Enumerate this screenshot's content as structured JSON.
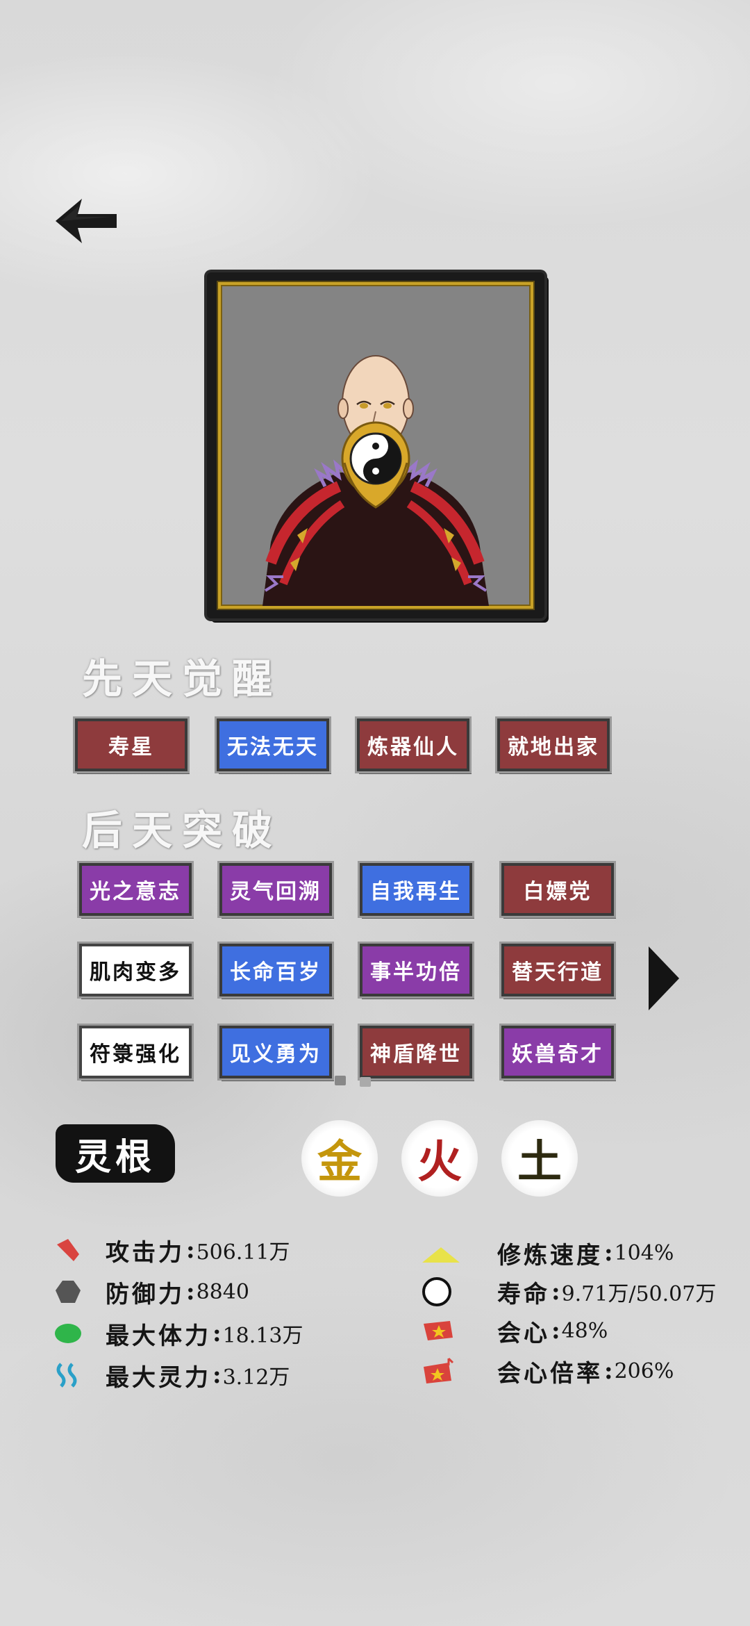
{
  "section_titles": {
    "innate": "先天觉醒",
    "acquired": "后天突破"
  },
  "innate_traits": [
    {
      "label": "寿星",
      "color": "red"
    },
    {
      "label": "无法无天",
      "color": "blue"
    },
    {
      "label": "炼器仙人",
      "color": "red"
    },
    {
      "label": "就地出家",
      "color": "red"
    }
  ],
  "acquired_traits": [
    {
      "label": "光之意志",
      "color": "purple"
    },
    {
      "label": "灵气回溯",
      "color": "purple"
    },
    {
      "label": "自我再生",
      "color": "blue"
    },
    {
      "label": "白嫖党",
      "color": "red"
    },
    {
      "label": "肌肉变多",
      "color": "white"
    },
    {
      "label": "长命百岁",
      "color": "blue"
    },
    {
      "label": "事半功倍",
      "color": "purple"
    },
    {
      "label": "替天行道",
      "color": "red"
    },
    {
      "label": "符箓强化",
      "color": "white"
    },
    {
      "label": "见义勇为",
      "color": "blue"
    },
    {
      "label": "神盾降世",
      "color": "red"
    },
    {
      "label": "妖兽奇才",
      "color": "purple"
    }
  ],
  "spiritual_root": {
    "label": "灵根",
    "elements": [
      "金",
      "火",
      "土"
    ]
  },
  "stats": [
    {
      "label": "攻击力",
      "value": "506.11万",
      "icon": "attack-icon"
    },
    {
      "label": "防御力",
      "value": "8840",
      "icon": "defense-icon"
    },
    {
      "label": "最大体力",
      "value": "18.13万",
      "icon": "health-icon"
    },
    {
      "label": "最大灵力",
      "value": "3.12万",
      "icon": "spirit-icon"
    },
    {
      "label": "修炼速度",
      "value": "104%",
      "icon": "cultivation-speed-icon"
    },
    {
      "label": "寿命",
      "value": "9.71万/50.07万",
      "icon": "lifespan-icon"
    },
    {
      "label": "会心",
      "value": "48%",
      "icon": "critical-icon"
    },
    {
      "label": "会心倍率",
      "value": "206%",
      "icon": "critical-multiplier-icon"
    }
  ],
  "colors": {
    "red": "#8e3b3d",
    "blue": "#3f6fe0",
    "purple": "#8a3ca8",
    "white": "#ffffff",
    "frame_gold": "#c9a227"
  }
}
